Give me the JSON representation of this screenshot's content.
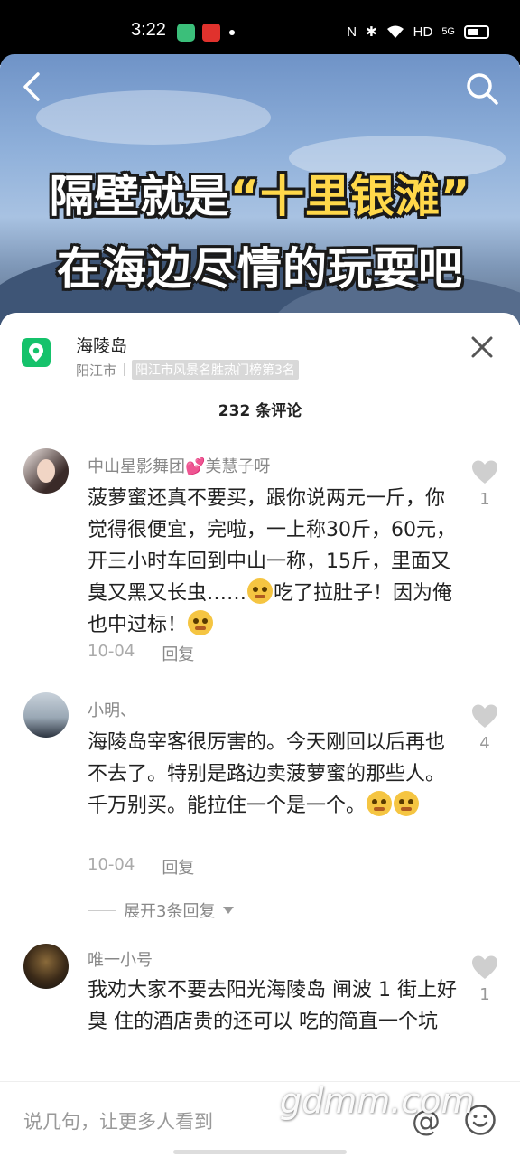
{
  "status_bar": {
    "time": "3:22",
    "network": "HD",
    "signal": "5G"
  },
  "video": {
    "title_line1_a": "隔壁就是",
    "title_line1_b": "“十里银滩”",
    "title_line2": "在海边尽情的玩耍吧"
  },
  "location": {
    "name": "海陵岛",
    "city": "阳江市",
    "rank": "阳江市风景名胜热门榜第3名"
  },
  "comments_title": "232 条评论",
  "comments": [
    {
      "user": "中山星影舞团💕美慧子呀",
      "text": "菠萝蜜还真不要买，跟你说两元一斤，你觉得很便宜，完啦，一上称30斤，60元，开三小时车回到中山一称，15斤，里面又臭又黑又长虫……",
      "text_tail": "吃了拉肚子！因为俺也中过标！",
      "date": "10-04",
      "reply": "回复",
      "likes": "1"
    },
    {
      "user": "小明、",
      "text": "海陵岛宰客很厉害的。今天刚回以后再也不去了。特别是路边卖菠萝蜜的那些人。千万别买。能拉住一个是一个。",
      "date": "10-04",
      "reply": "回复",
      "likes": "4"
    },
    {
      "user": "唯一小号",
      "text": "我劝大家不要去阳光海陵岛 闸波 1 街上好臭 住的酒店贵的还可以 吃的简直一个坑",
      "likes": "1"
    }
  ],
  "expand_replies": "展开3条回复",
  "input_placeholder": "说几句，让更多人看到",
  "watermark": "gdmm.com",
  "colors": {
    "location_icon": "#15c26b",
    "highlight": "#ffd84a"
  }
}
